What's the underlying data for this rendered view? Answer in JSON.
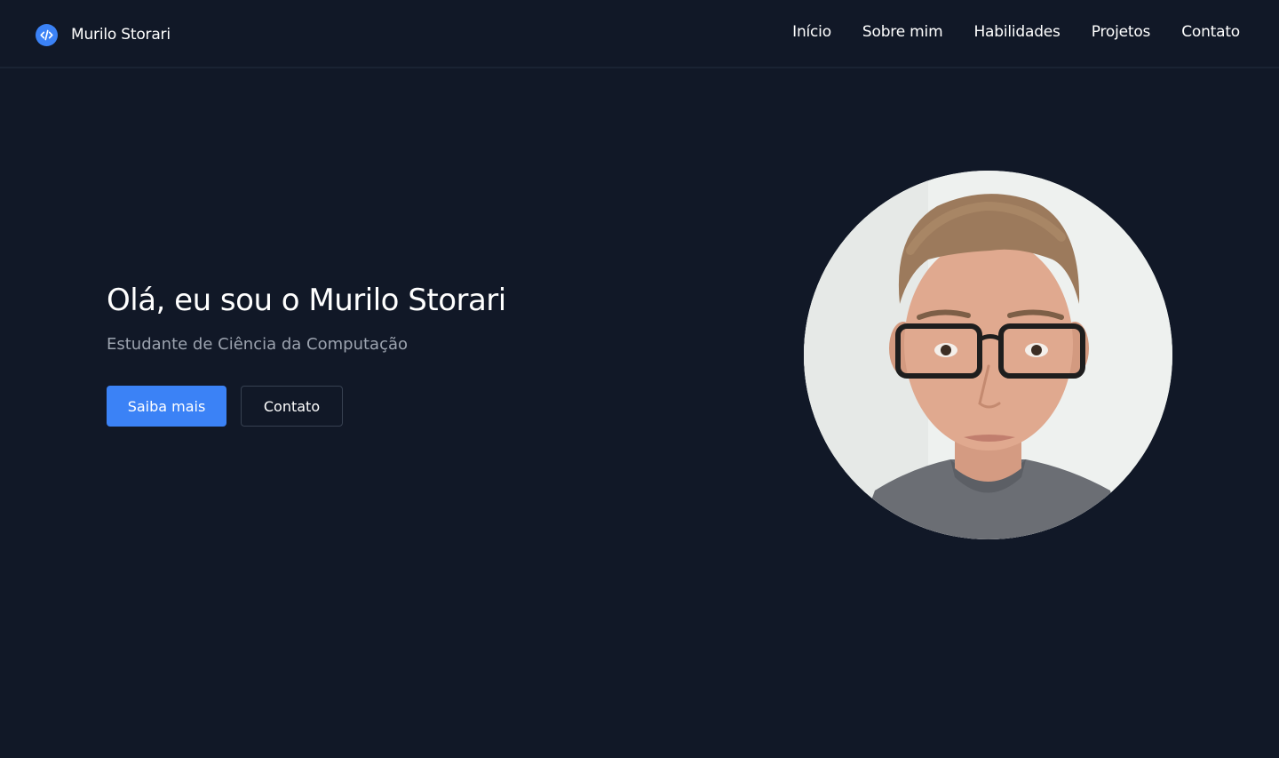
{
  "brand": {
    "name": "Murilo Storari",
    "icon": "code-icon",
    "accent_color": "#3b82f6"
  },
  "nav": {
    "items": [
      {
        "label": "Início"
      },
      {
        "label": "Sobre mim"
      },
      {
        "label": "Habilidades"
      },
      {
        "label": "Projetos"
      },
      {
        "label": "Contato"
      }
    ]
  },
  "hero": {
    "title": "Olá, eu sou o Murilo Storari",
    "subtitle": "Estudante de Ciência da Computação",
    "primary_button": "Saiba mais",
    "secondary_button": "Contato"
  },
  "colors": {
    "background": "#111827",
    "subtitle": "#9ca3af",
    "primary": "#3b82f6"
  }
}
